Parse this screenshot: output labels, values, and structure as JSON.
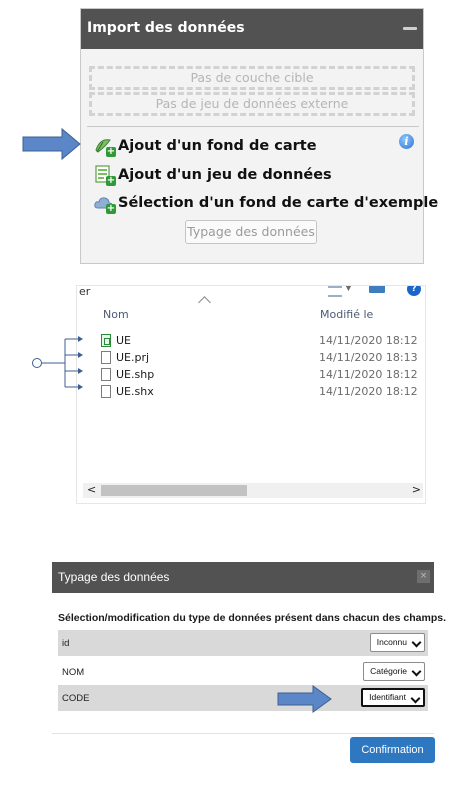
{
  "import_panel": {
    "title": "Import des données",
    "slot_target_layer": "Pas de couche cible",
    "slot_external_dataset": "Pas de jeu de données externe",
    "actions": [
      {
        "label": "Ajout d'un fond de carte",
        "icon": "basemap-add-icon"
      },
      {
        "label": "Ajout d'un jeu de données",
        "icon": "dataset-add-icon"
      },
      {
        "label": "Sélection d'un fond de carte d'exemple",
        "icon": "cloud-add-icon"
      }
    ],
    "typage_button": "Typage des données"
  },
  "explorer": {
    "fragment_text": "er",
    "columns": {
      "name": "Nom",
      "modified": "Modifié le"
    },
    "files": [
      {
        "name": "UE",
        "date": "14/11/2020 18:12",
        "icon": "spreadsheet-file-icon"
      },
      {
        "name": "UE.prj",
        "date": "14/11/2020 18:13",
        "icon": "file-icon"
      },
      {
        "name": "UE.shp",
        "date": "14/11/2020 18:12",
        "icon": "file-icon"
      },
      {
        "name": "UE.shx",
        "date": "14/11/2020 18:12",
        "icon": "file-icon"
      }
    ],
    "scroll_left": "<",
    "scroll_right": ">"
  },
  "typage_dialog": {
    "title": "Typage des données",
    "close": "×",
    "description": "Sélection/modification du type de données présent dans chacun des champs.",
    "fields": [
      {
        "field": "id",
        "type": "Inconnu"
      },
      {
        "field": "NOM",
        "type": "Catégorie"
      },
      {
        "field": "CODE",
        "type": "Identifiant"
      }
    ],
    "confirm": "Confirmation"
  },
  "colors": {
    "header_bg": "#525252",
    "arrow_fill": "#5b87c9",
    "confirm_bg": "#2e78c2",
    "plus_badge": "#2f9a37"
  }
}
